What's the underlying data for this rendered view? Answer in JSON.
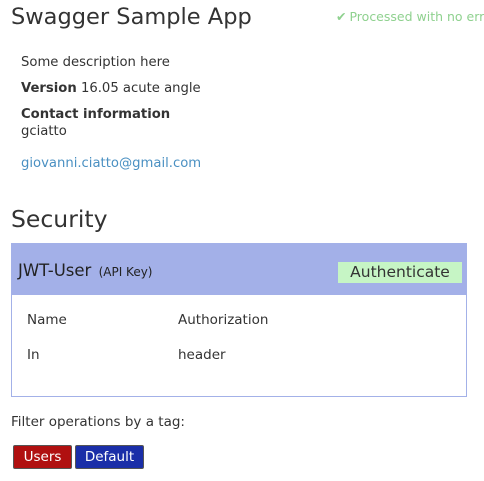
{
  "app": {
    "title": "Swagger Sample App",
    "status_text": "Processed with no errors"
  },
  "info": {
    "description": "Some description here",
    "version_label": "Version",
    "version_value": "16.05 acute angle",
    "contact_heading": "Contact information",
    "contact_name": "gciatto",
    "contact_email": "giovanni.ciatto@gmail.com"
  },
  "security": {
    "title": "Security",
    "scheme": {
      "name": "JWT-User",
      "type": "(API Key)",
      "authenticate_label": "Authenticate",
      "rows": [
        {
          "key": "Name",
          "value": "Authorization"
        },
        {
          "key": "In",
          "value": "header"
        }
      ]
    }
  },
  "filter": {
    "label": "Filter operations by a tag:",
    "tags": [
      {
        "label": "Users",
        "color": "#b01010"
      },
      {
        "label": "Default",
        "color": "#1a2ea8"
      }
    ]
  },
  "colors": {
    "accent_header": "#a3b0e8",
    "authenticate_bg": "#c6f5c5",
    "link": "#4a90c2",
    "status_ok": "#8fd18f"
  },
  "icons": {
    "status": "check-icon"
  }
}
